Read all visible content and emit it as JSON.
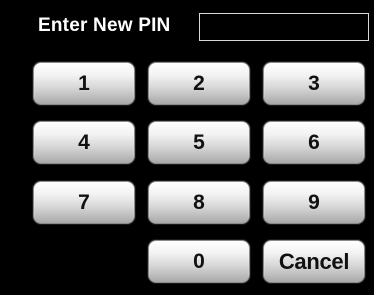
{
  "header": {
    "title": "Enter New PIN",
    "pin_value": "",
    "pin_placeholder": ""
  },
  "keypad": {
    "keys": [
      "1",
      "2",
      "3",
      "4",
      "5",
      "6",
      "7",
      "8",
      "9",
      "0"
    ],
    "cancel_label": "Cancel"
  },
  "colors": {
    "background": "#000000",
    "text": "#ffffff",
    "key_text": "#111111",
    "key_gradient_top": "#ffffff",
    "key_gradient_bottom": "#a9a9a9"
  }
}
